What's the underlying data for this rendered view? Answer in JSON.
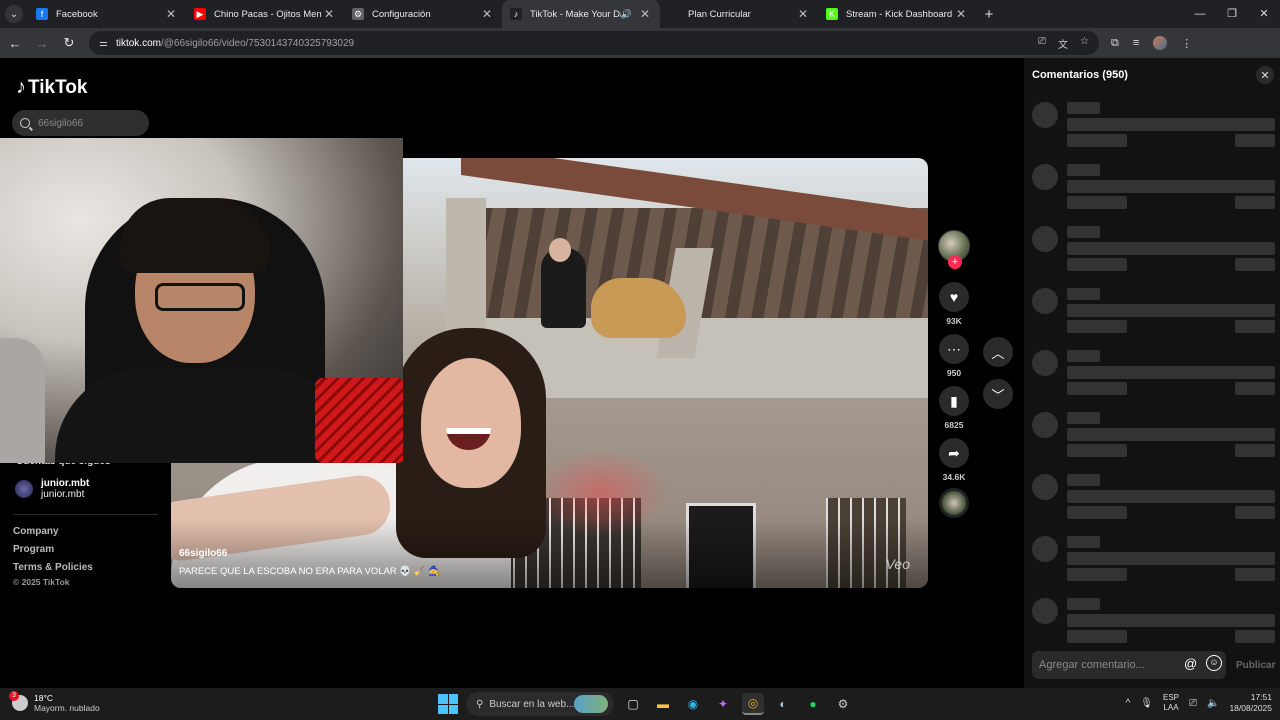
{
  "browser": {
    "tabs": [
      {
        "label": "Facebook",
        "icon": "facebook-icon",
        "color": "#1877f2",
        "glyph": "f",
        "active": false
      },
      {
        "label": "Chino Pacas - Ojitos Mentirosos",
        "icon": "youtube-icon",
        "color": "#ff0000",
        "glyph": "▶",
        "active": false
      },
      {
        "label": "Configuración",
        "icon": "gear-icon",
        "color": "#5f6368",
        "glyph": "⚙",
        "active": false
      },
      {
        "label": "TikTok - Make Your Day",
        "icon": "tiktok-icon",
        "color": "#202124",
        "glyph": "♪",
        "active": true
      },
      {
        "label": "Plan Curricular",
        "icon": "blank-page-icon",
        "color": "#202124",
        "glyph": "",
        "active": false
      },
      {
        "label": "Stream - Kick Dashboard",
        "icon": "kick-icon",
        "color": "#53fc18",
        "glyph": "K",
        "active": false
      }
    ],
    "url_host": "tiktok.com",
    "url_path": "/@66sigilo66/video/7530143740325793029"
  },
  "tiktok": {
    "logo_text": "TikTok",
    "search_value": "66sigilo66",
    "following_heading": "Cuentas que sigues",
    "followed_account": {
      "name": "junior.mbt",
      "handle": "junior.mbt"
    },
    "footer_links": [
      "Company",
      "Program",
      "Terms & Policies"
    ],
    "copyright": "© 2025 TikTok",
    "video": {
      "username": "66sigilo66",
      "caption": "PARECE QUE LA ESCOBA NO ERA PARA VOLAR 💀 🧹 🧙",
      "watermark": "Veo"
    },
    "actions": {
      "likes": "93K",
      "comments": "950",
      "saves": "6825",
      "shares": "34.6K"
    },
    "comments_panel": {
      "title": "Comentarios (950)",
      "input_placeholder": "Agregar comentario...",
      "post_label": "Publicar"
    }
  },
  "taskbar": {
    "weather_temp": "18°C",
    "weather_desc": "Mayorm. nublado",
    "weather_badge": "3",
    "search_placeholder": "Buscar en la web...",
    "lang_line1": "ESP",
    "lang_line2": "LAA",
    "time": "17:51",
    "date": "18/08/2025"
  }
}
